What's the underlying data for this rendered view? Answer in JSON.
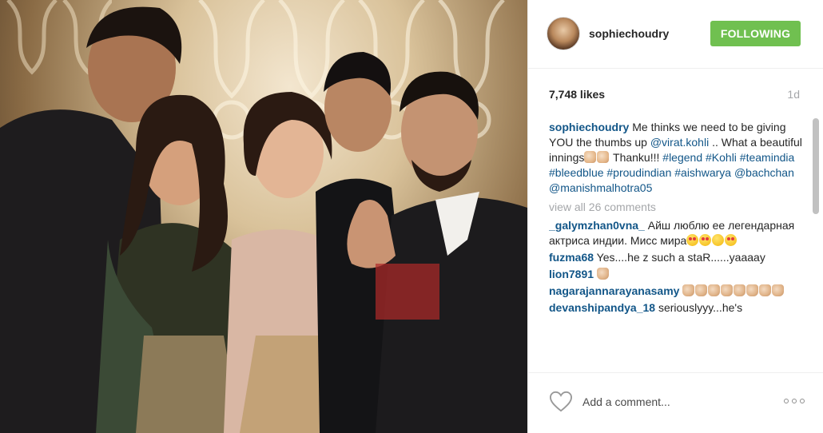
{
  "post": {
    "username": "sophiechoudry",
    "follow_label": "FOLLOWING",
    "likes": "7,748 likes",
    "age": "1d",
    "caption": {
      "user": "sophiechoudry",
      "text_1": " Me thinks we need to be giving YOU the thumbs up ",
      "mention_1": "@virat.kohli",
      "text_2": " .. What a beautiful innings",
      "text_3": " Thanku!!! ",
      "hashtags": "#legend #Kohli #teamindia #bleedblue #proudindian #aishwarya @bachchan @manishmalhotra05"
    },
    "view_all": "view all 26 comments",
    "comments": [
      {
        "user": "_galymzhan0vna_",
        "text": " Айш люблю ее легендарная актриса индии. Мисс мира"
      },
      {
        "user": "fuzma68",
        "text": " Yes....he z such a staR......yaaaay"
      },
      {
        "user": "lion7891",
        "text": " "
      },
      {
        "user": "nagarajannarayanasamy",
        "text": " "
      },
      {
        "user": "devanshipandya_18",
        "text": " seriouslyyy...he's"
      }
    ],
    "add_comment_placeholder": "Add a comment..."
  },
  "colors": {
    "link": "#125688",
    "follow_green": "#70c050",
    "muted": "#a5a7aa"
  },
  "icons": {
    "heart": "heart-outline-icon",
    "more": "more-options-icon"
  }
}
